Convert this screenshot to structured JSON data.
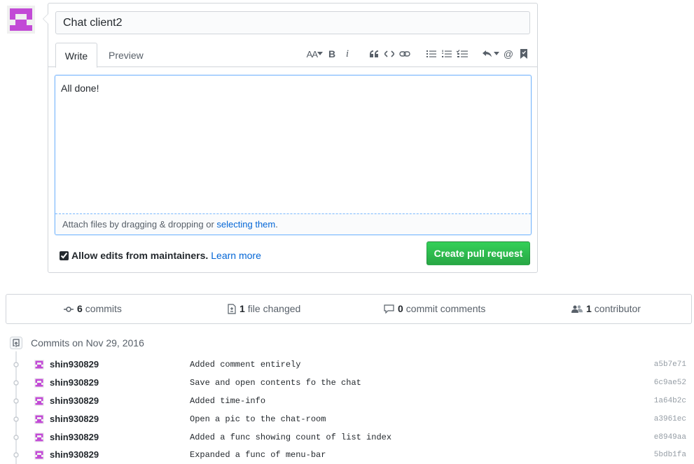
{
  "compose": {
    "title_value": "Chat client2",
    "tabs": {
      "write": "Write",
      "preview": "Preview"
    },
    "toolbar": {
      "text_size": "AA",
      "bold": "B",
      "italic": "i",
      "mention": "@"
    },
    "body_value": "All done!",
    "attach_hint": "Attach files by dragging & dropping or ",
    "attach_link": "selecting them",
    "attach_suffix": ".",
    "allow_edits_label": "Allow edits from maintainers.",
    "learn_more": "Learn more",
    "create_button": "Create pull request"
  },
  "summary": {
    "commits_count": "6",
    "commits_label": "commits",
    "files_count": "1",
    "files_label": "file changed",
    "comments_count": "0",
    "comments_label": "commit comments",
    "contributors_count": "1",
    "contributors_label": "contributor"
  },
  "commits": {
    "group_title": "Commits on Nov 29, 2016",
    "items": [
      {
        "author": "shin930829",
        "message": "Added comment entirely",
        "sha": "a5b7e71"
      },
      {
        "author": "shin930829",
        "message": "Save and open contents fo the chat",
        "sha": "6c9ae52"
      },
      {
        "author": "shin930829",
        "message": "Added time-info",
        "sha": "1a64b2c"
      },
      {
        "author": "shin930829",
        "message": "Open a pic to the chat-room",
        "sha": "a3961ec"
      },
      {
        "author": "shin930829",
        "message": "Added a func showing count of list index",
        "sha": "e8949aa"
      },
      {
        "author": "shin930829",
        "message": "Expanded a func of menu-bar",
        "sha": "5bdb1fa"
      }
    ]
  },
  "colors": {
    "avatar": "#c24ad6",
    "link": "#0366d6",
    "button_green": "#28a745"
  }
}
